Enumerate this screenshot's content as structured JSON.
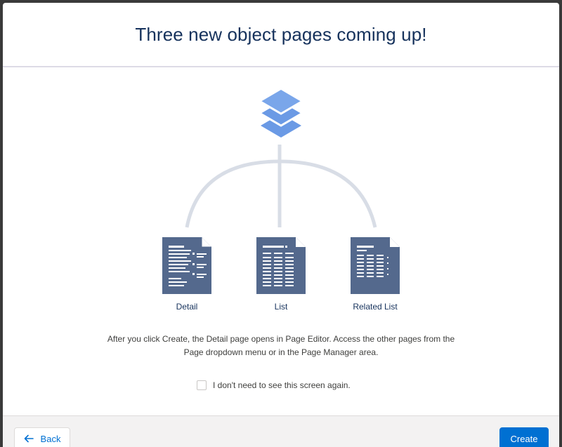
{
  "modal": {
    "title": "Three new object pages coming up!"
  },
  "illustration": {
    "icon": "layers-stack-icon",
    "accent_color": "#6b9ae5",
    "connector_color": "#d8dde6",
    "page_color": "#54698d",
    "pages": [
      {
        "label": "Detail",
        "icon": "detail-page-icon"
      },
      {
        "label": "List",
        "icon": "list-page-icon"
      },
      {
        "label": "Related List",
        "icon": "related-list-page-icon"
      }
    ]
  },
  "description": "After you click Create, the Detail page opens in Page Editor. Access the other pages from the Page dropdown menu or in the Page Manager area.",
  "dont_show_again": {
    "label": "I don't need to see this screen again.",
    "checked": false
  },
  "footer": {
    "back_label": "Back",
    "create_label": "Create",
    "brand_color": "#0070d2"
  }
}
